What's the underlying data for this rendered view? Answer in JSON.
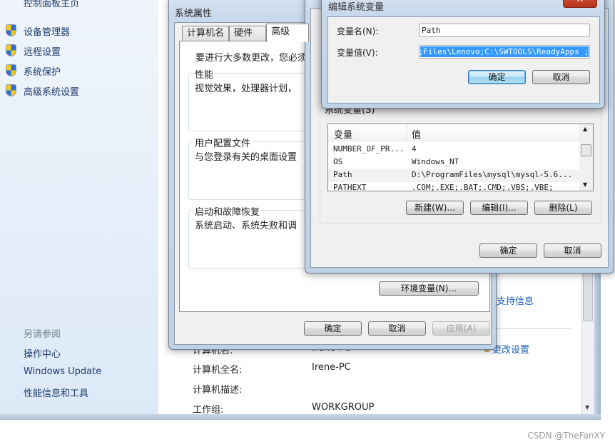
{
  "sidebar": {
    "home": "控制面板主页",
    "items": [
      {
        "label": "设备管理器",
        "icon": "uac-shield-icon"
      },
      {
        "label": "远程设置",
        "icon": "uac-shield-icon"
      },
      {
        "label": "系统保护",
        "icon": "uac-shield-icon"
      },
      {
        "label": "高级系统设置",
        "icon": "uac-shield-icon"
      }
    ],
    "see_also": "另请参阅",
    "links": [
      "操作中心",
      "Windows Update",
      "性能信息和工具"
    ]
  },
  "main": {
    "support_link": "支持信息",
    "change_settings": "更改设置",
    "rows": [
      {
        "label": "计算机名:",
        "value": "Irene-PC"
      },
      {
        "label": "计算机全名:",
        "value": "Irene-PC"
      },
      {
        "label": "计算机描述:",
        "value": ""
      },
      {
        "label": "工作组:",
        "value": "WORKGROUP"
      }
    ]
  },
  "sysprops": {
    "title": "系统属性",
    "tabs": [
      "计算机名",
      "硬件",
      "高级"
    ],
    "active_tab": "高级",
    "intro": "要进行大多数更改，您必须",
    "groups": [
      {
        "title": "性能",
        "desc": "视觉效果，处理器计划，"
      },
      {
        "title": "用户配置文件",
        "desc": "与您登录有关的桌面设置"
      },
      {
        "title": "启动和故障恢复",
        "desc": "系统启动、系统失败和调"
      }
    ],
    "env_button": "环境变量(N)...",
    "ok": "确定",
    "cancel": "取消",
    "apply": "应用(A)"
  },
  "envvars": {
    "group_title": "系统变量(S)",
    "columns": [
      "变量",
      "值"
    ],
    "rows": [
      {
        "name": "NUMBER_OF_PR...",
        "value": "4"
      },
      {
        "name": "OS",
        "value": "Windows_NT"
      },
      {
        "name": "Path",
        "value": "D:\\ProgramFiles\\mysql\\mysql-5.6..."
      },
      {
        "name": "PATHEXT",
        "value": ".COM;.EXE;.BAT;.CMD;.VBS;.VBE;"
      }
    ],
    "selected_row": "Path",
    "new": "新建(W)...",
    "edit": "编辑(I)...",
    "delete": "删除(L)",
    "ok": "确定",
    "cancel": "取消"
  },
  "editvar": {
    "title": "编辑系统变量",
    "name_label": "变量名(N):",
    "name_value": "Path",
    "value_label": "变量值(V):",
    "value_value": "; Files\\Lenovo;C:\\SWTOOLS\\ReadyApps;",
    "ok": "确定",
    "cancel": "取消"
  },
  "watermark": "CSDN @TheFanXY"
}
